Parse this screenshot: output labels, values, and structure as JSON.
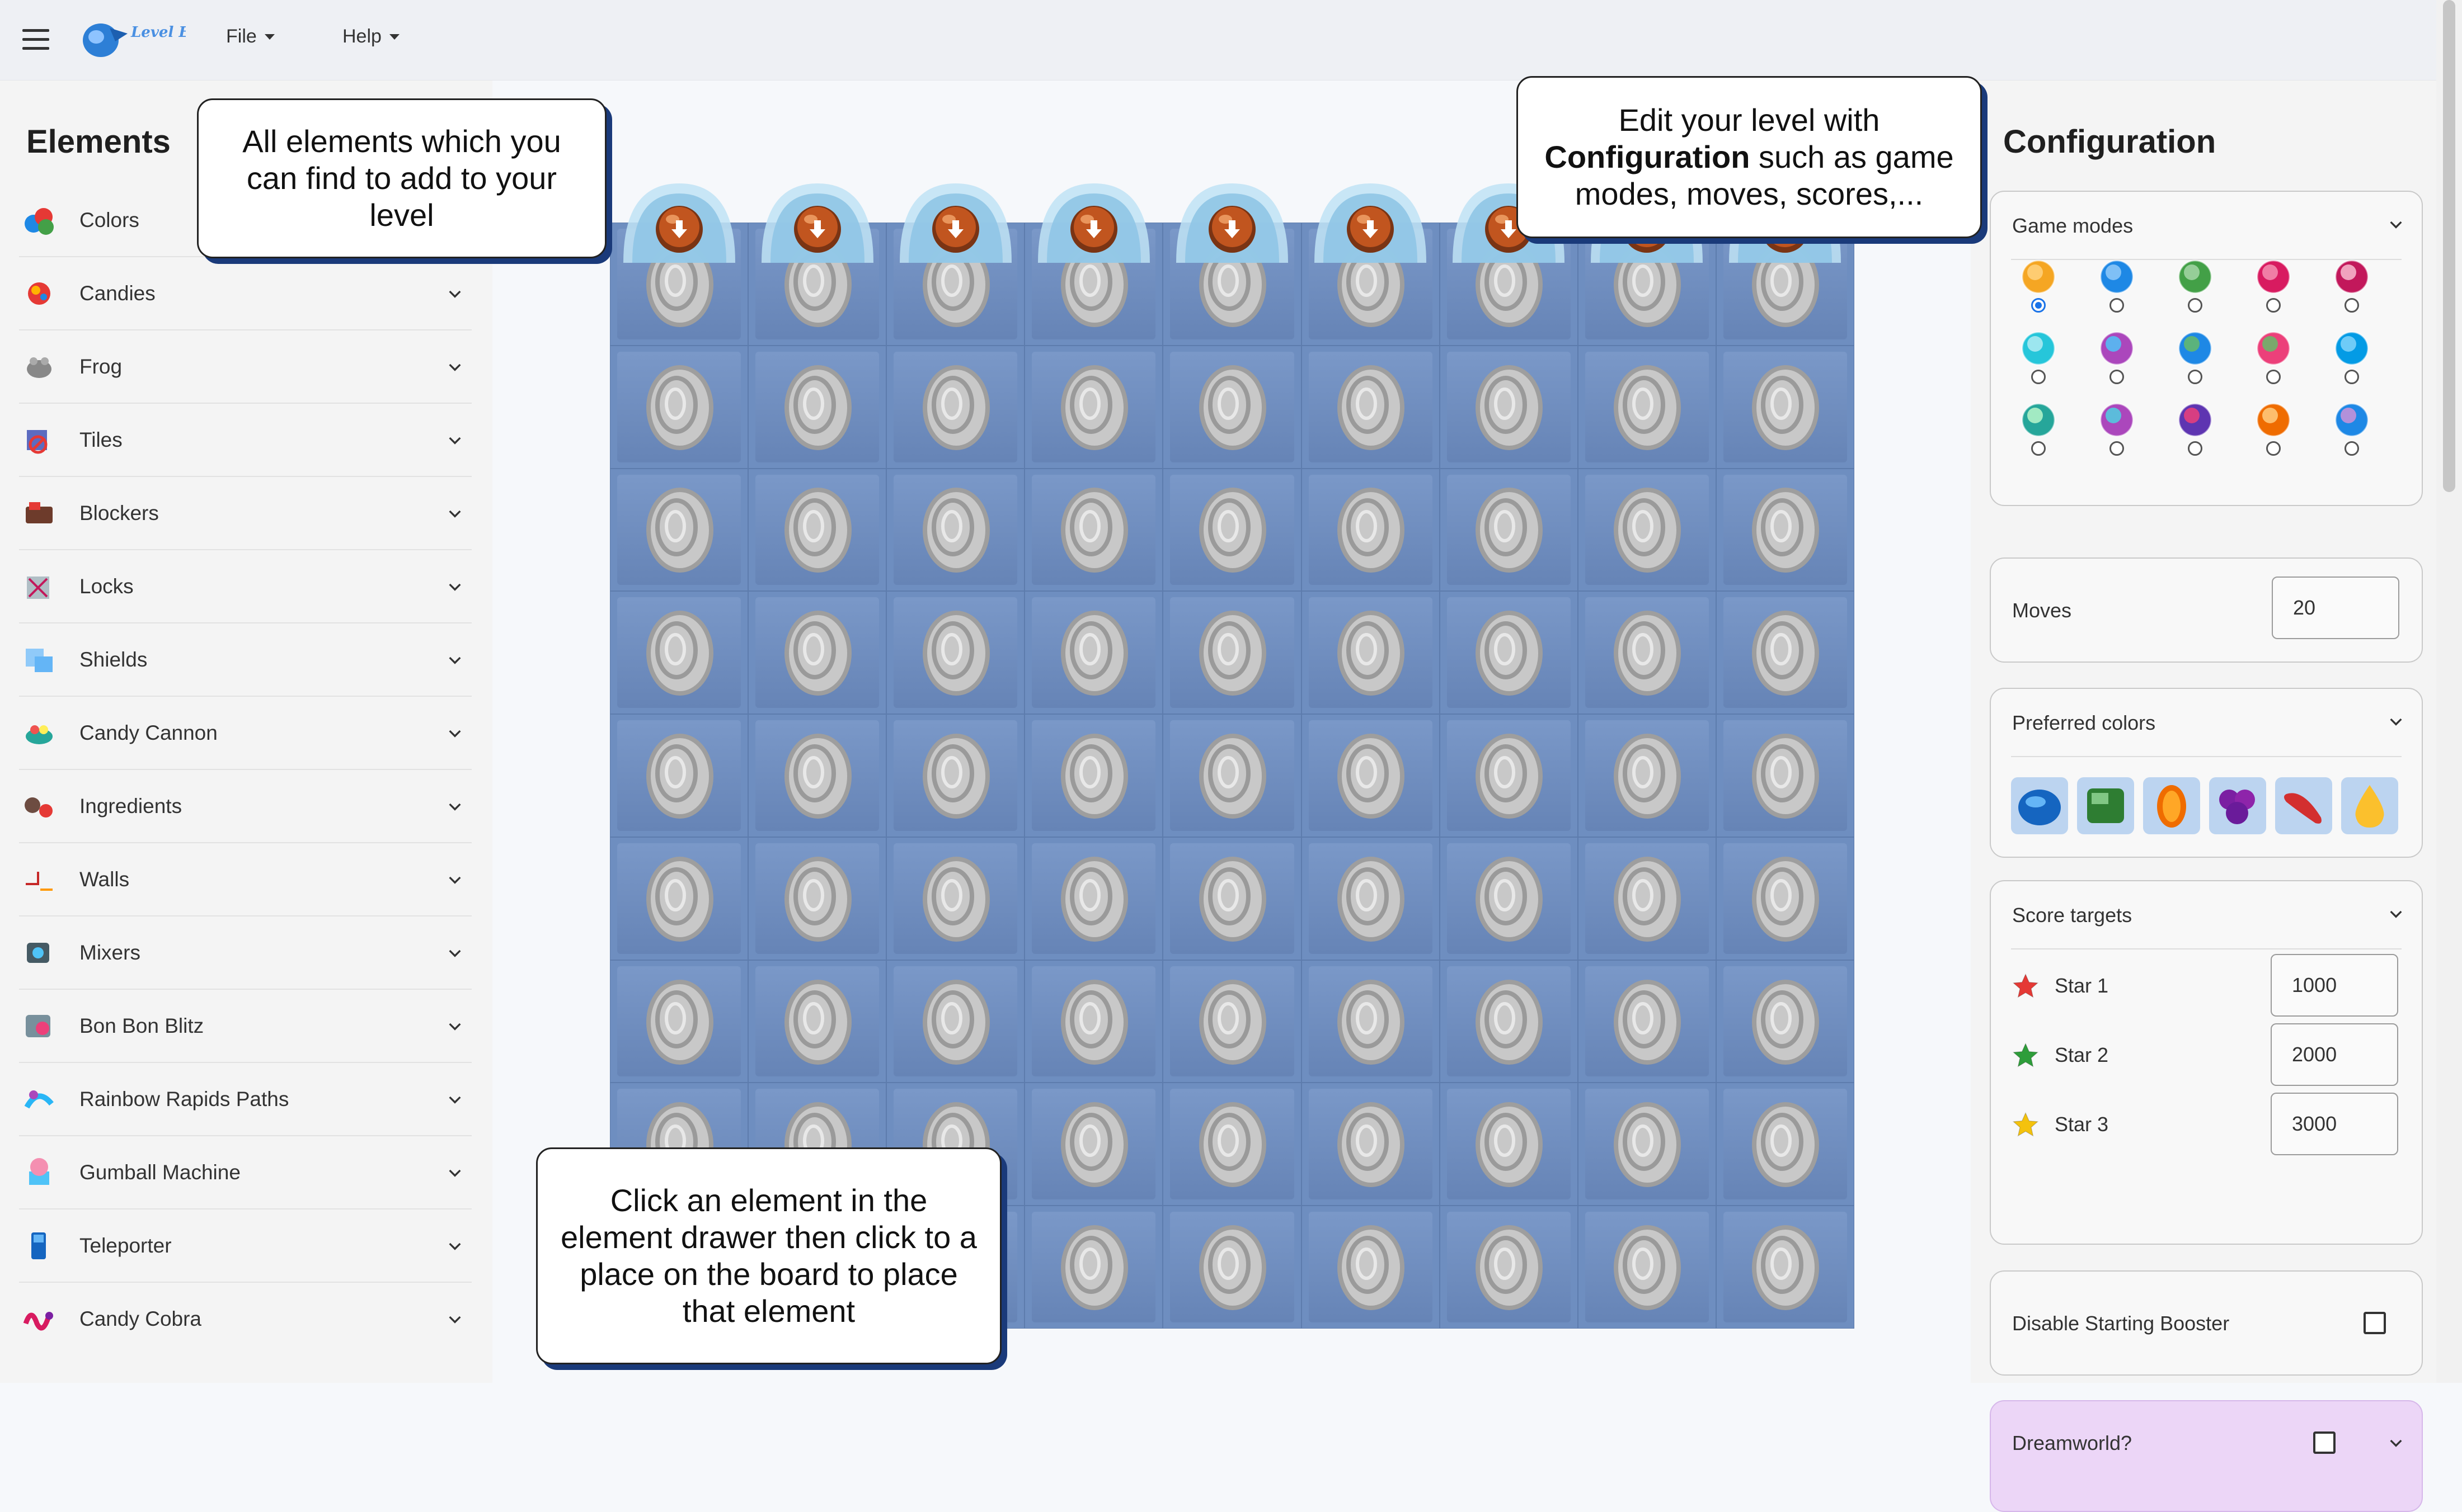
{
  "menu": {
    "file_label": "File",
    "help_label": "Help",
    "logo_text": "Level Editor"
  },
  "sidebar": {
    "title": "Elements",
    "categories": [
      {
        "label": "Colors",
        "icon": "colors-icon"
      },
      {
        "label": "Candies",
        "icon": "candies-icon"
      },
      {
        "label": "Frog",
        "icon": "frog-icon"
      },
      {
        "label": "Tiles",
        "icon": "tiles-icon"
      },
      {
        "label": "Blockers",
        "icon": "blockers-icon"
      },
      {
        "label": "Locks",
        "icon": "locks-icon"
      },
      {
        "label": "Shields",
        "icon": "shields-icon"
      },
      {
        "label": "Candy Cannon",
        "icon": "candy-cannon-icon"
      },
      {
        "label": "Ingredients",
        "icon": "ingredients-icon"
      },
      {
        "label": "Walls",
        "icon": "walls-icon"
      },
      {
        "label": "Mixers",
        "icon": "mixers-icon"
      },
      {
        "label": "Bon Bon Blitz",
        "icon": "bon-bon-blitz-icon"
      },
      {
        "label": "Rainbow Rapids Paths",
        "icon": "rainbow-rapids-icon"
      },
      {
        "label": "Gumball Machine",
        "icon": "gumball-machine-icon"
      },
      {
        "label": "Teleporter",
        "icon": "teleporter-icon"
      },
      {
        "label": "Candy Cobra",
        "icon": "candy-cobra-icon"
      }
    ]
  },
  "board": {
    "columns": 9,
    "rows": 9,
    "cell_content": "silver-coin",
    "spawner_row": "candy-cannon-spawners"
  },
  "config": {
    "title": "Configuration",
    "game_modes": {
      "label": "Game modes",
      "selected_index": 0,
      "count": 15
    },
    "moves": {
      "label": "Moves",
      "value": "20"
    },
    "preferred_colors": {
      "label": "Preferred colors",
      "colors": [
        "blue",
        "green",
        "orange",
        "purple",
        "red",
        "yellow"
      ]
    },
    "score_targets": {
      "label": "Score targets",
      "stars": [
        {
          "label": "Star 1",
          "value": "1000",
          "color": "#e53935"
        },
        {
          "label": "Star 2",
          "value": "2000",
          "color": "#2e9d3a"
        },
        {
          "label": "Star 3",
          "value": "3000",
          "color": "#f4c20d"
        }
      ]
    },
    "disable_booster": {
      "label": "Disable Starting Booster",
      "checked": false
    },
    "dreamworld": {
      "label": "Dreamworld?",
      "checked": false
    }
  },
  "callouts": {
    "elements": "All elements which you can find to add to your level",
    "config_pre": "Edit your level with",
    "config_bold": "Configuration",
    "config_post": "such as game modes, moves, scores,...",
    "board": "Click an element in the element drawer then click to a place on the board to place that element"
  }
}
